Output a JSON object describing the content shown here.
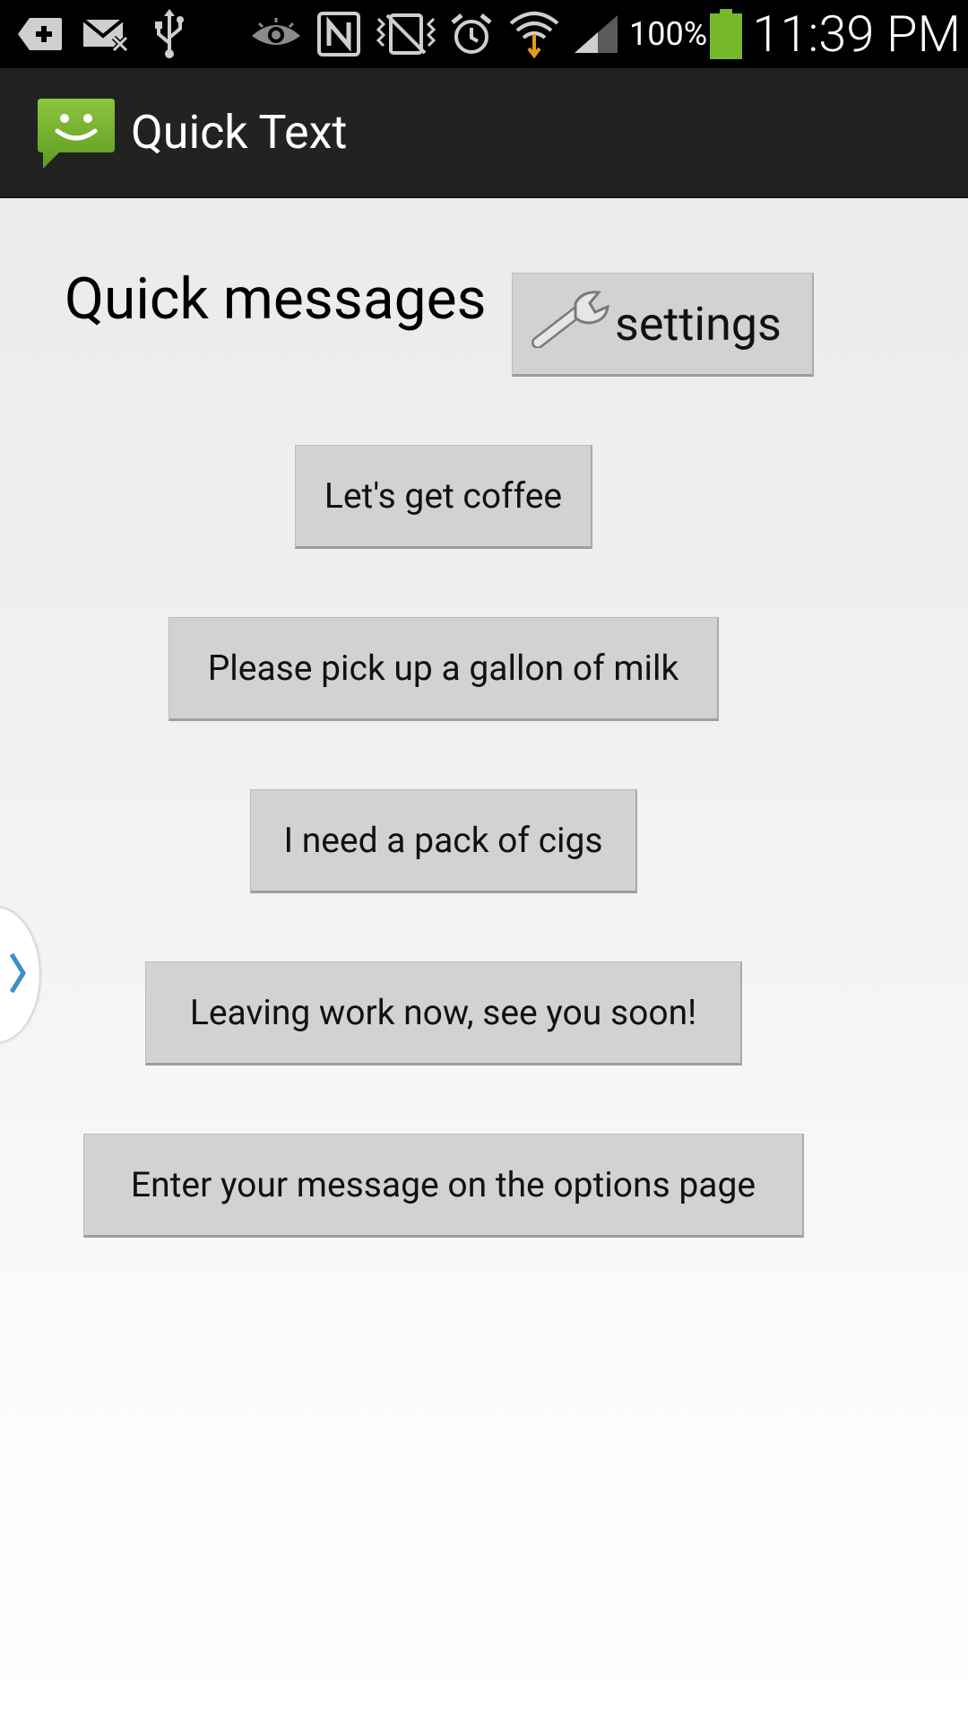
{
  "status_bar": {
    "icons": [
      "add-notification-icon",
      "missed-email-icon",
      "usb-icon",
      "smart-stay-eye-icon",
      "nfc-icon",
      "vibrate-mute-icon",
      "alarm-icon",
      "wifi-icon",
      "cell-signal-icon",
      "battery-icon"
    ],
    "battery_percent": "100%",
    "time": "11:39 PM"
  },
  "action_bar": {
    "title": "Quick Text",
    "icon": "smiley-message-icon",
    "icon_color": "#76b82a"
  },
  "main": {
    "heading": "Quick messages",
    "settings_label": "settings",
    "settings_icon": "wrench-icon",
    "messages": [
      "Let's get coffee",
      "Please pick up a gallon of milk",
      "I need a pack of cigs",
      "Leaving work now, see you soon!",
      "Enter your message on the options page"
    ]
  },
  "side_handle": {
    "icon": "chevron-right-icon",
    "color": "#3d8fc6"
  }
}
